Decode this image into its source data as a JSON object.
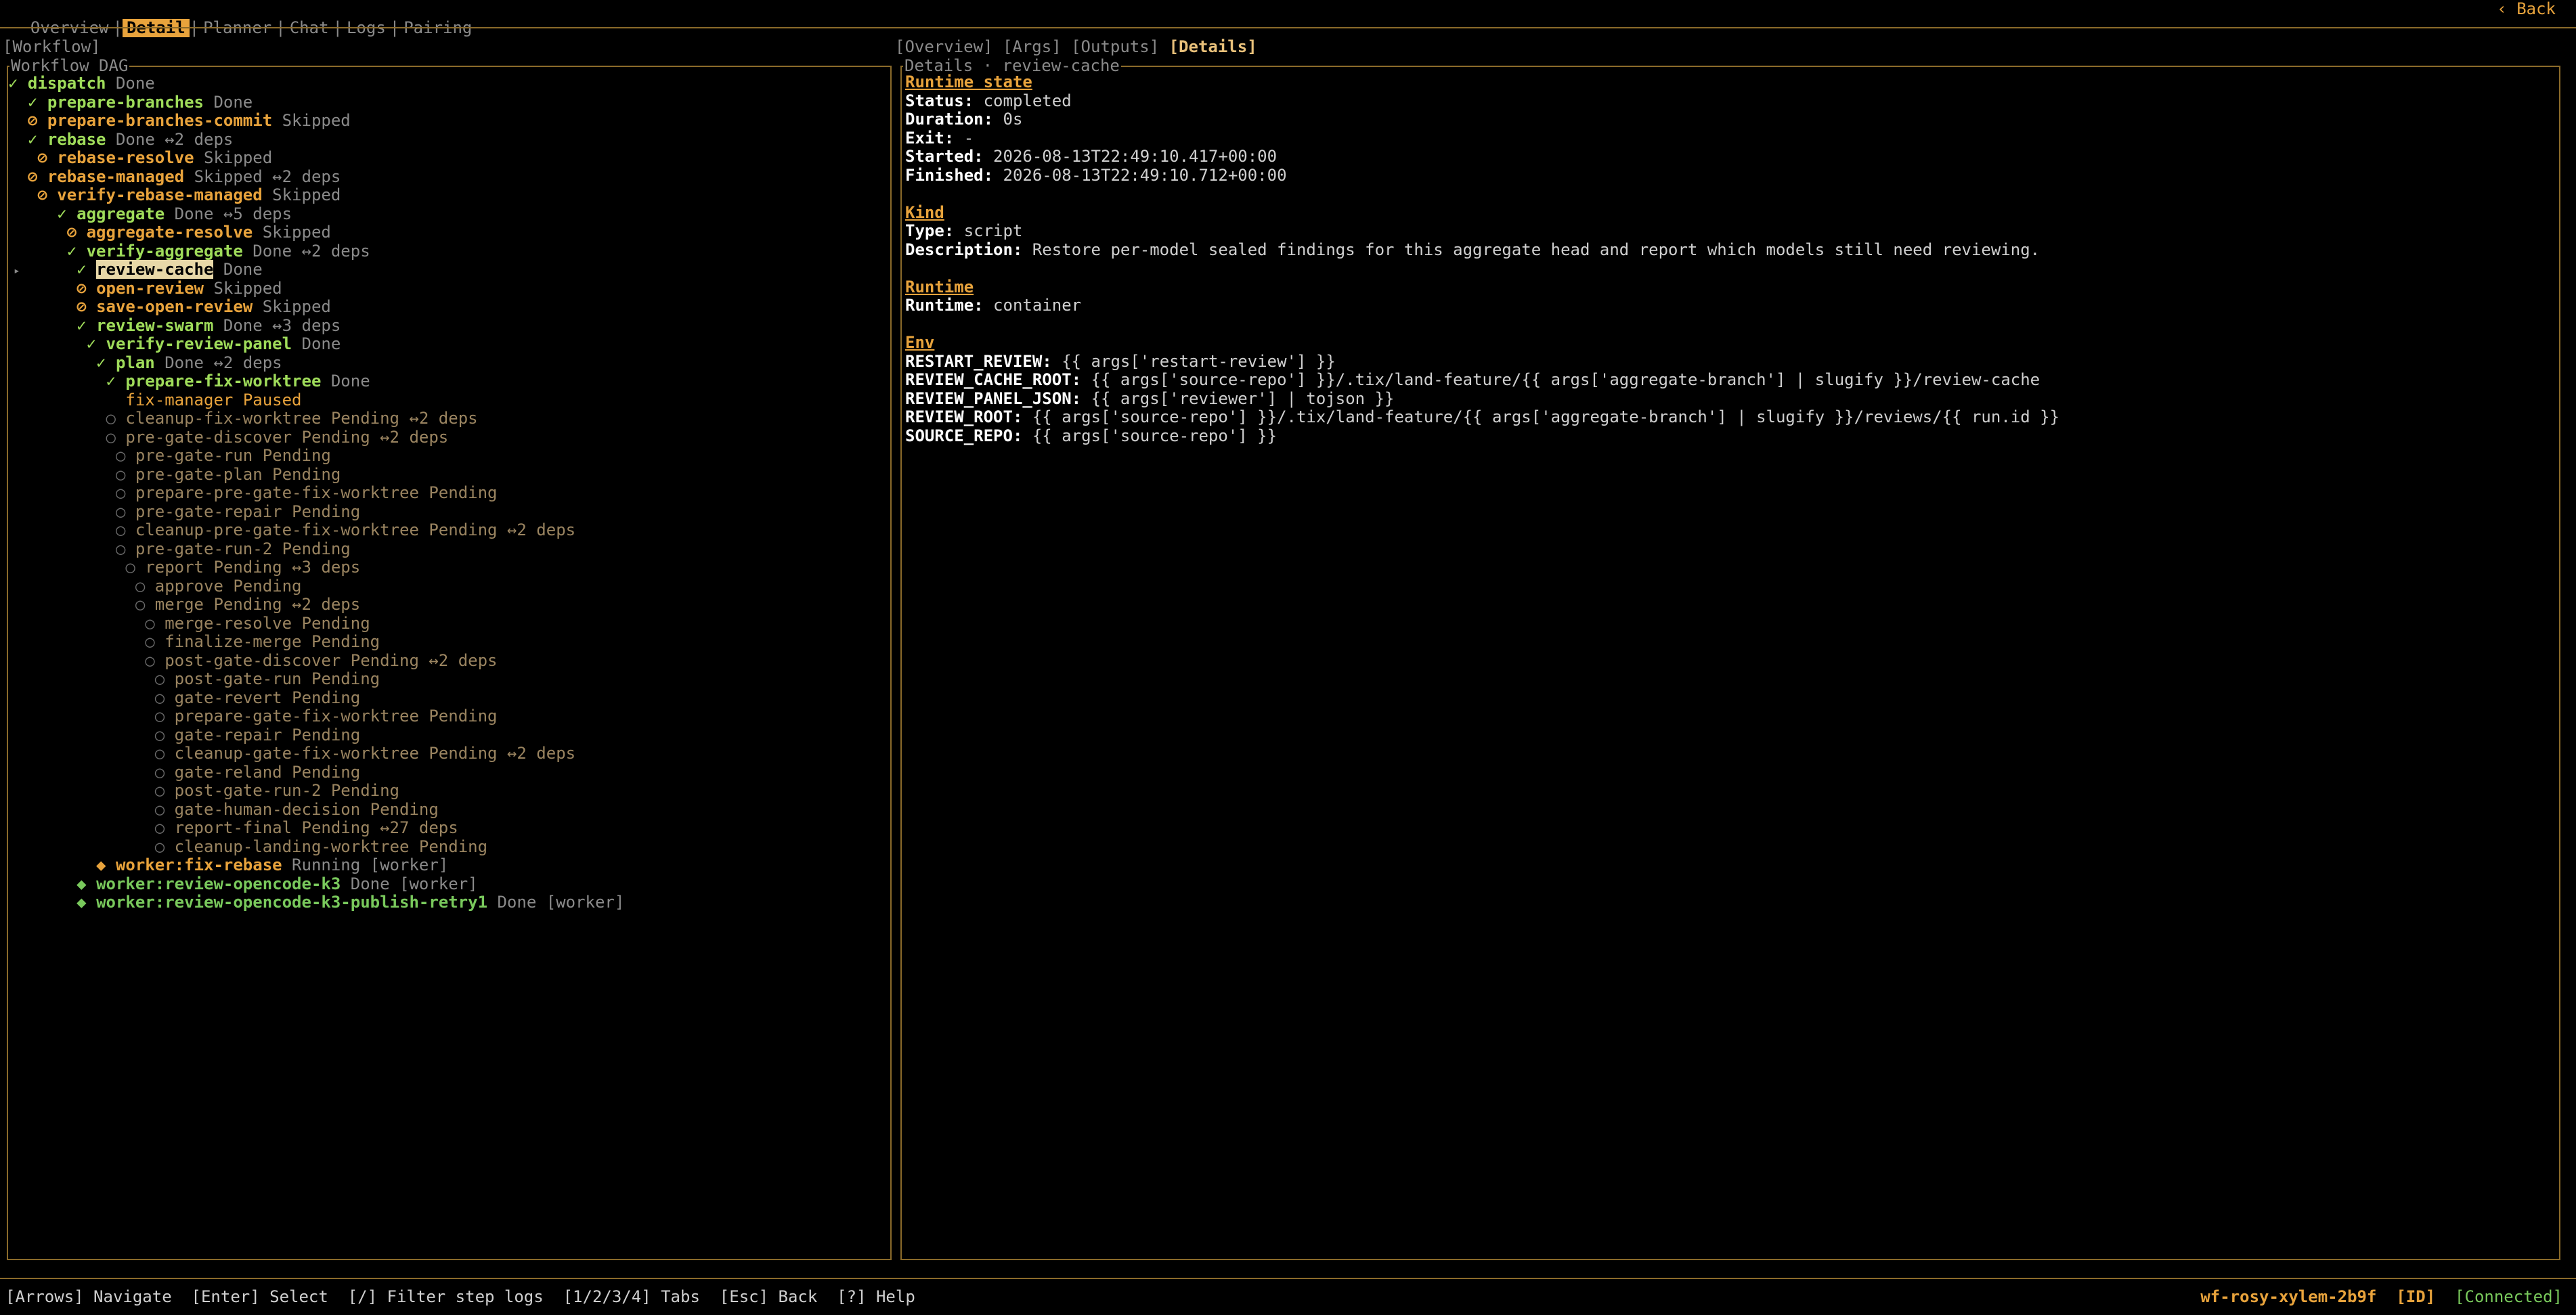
{
  "top_tabs": [
    "Overview",
    "Detail",
    "Planner",
    "Chat",
    "Logs",
    "Pairing"
  ],
  "back_label": "‹ Back",
  "workflow_label": "[Workflow]",
  "dag_title": "Workflow DAG",
  "detail_tabs": [
    "[Overview]",
    "[Args]",
    "[Outputs]",
    "[Details]"
  ],
  "details_title": "Details · review-cache",
  "tree": [
    {
      "g": "",
      "icon": "✓",
      "k": "done",
      "name": "dispatch",
      "status": "Done",
      "deps": ""
    },
    {
      "g": "  ",
      "icon": "✓",
      "k": "done",
      "name": "prepare-branches",
      "status": "Done",
      "deps": ""
    },
    {
      "g": "  ",
      "icon": "⊘",
      "k": "skip",
      "name": "prepare-branches-commit",
      "status": "Skipped",
      "deps": ""
    },
    {
      "g": "  ",
      "icon": "✓",
      "k": "done",
      "name": "rebase",
      "status": "Done",
      "deps": "↔2 deps"
    },
    {
      "g": "   ",
      "icon": "⊘",
      "k": "skip",
      "name": "rebase-resolve",
      "status": "Skipped",
      "deps": ""
    },
    {
      "g": "  ",
      "icon": "⊘",
      "k": "skip",
      "name": "rebase-managed",
      "status": "Skipped",
      "deps": "↔2 deps"
    },
    {
      "g": "   ",
      "icon": "⊘",
      "k": "skip",
      "name": "verify-rebase-managed",
      "status": "Skipped",
      "deps": ""
    },
    {
      "g": "     ",
      "icon": "✓",
      "k": "done",
      "name": "aggregate",
      "status": "Done",
      "deps": "↔5 deps"
    },
    {
      "g": "      ",
      "icon": "⊘",
      "k": "skip",
      "name": "aggregate-resolve",
      "status": "Skipped",
      "deps": ""
    },
    {
      "g": "      ",
      "icon": "✓",
      "k": "done",
      "name": "verify-aggregate",
      "status": "Done",
      "deps": "↔2 deps"
    },
    {
      "g": "       ",
      "icon": "✓",
      "k": "sel",
      "name": "review-cache",
      "status": "Done",
      "deps": ""
    },
    {
      "g": "       ",
      "icon": "⊘",
      "k": "skip",
      "name": "open-review",
      "status": "Skipped",
      "deps": ""
    },
    {
      "g": "       ",
      "icon": "⊘",
      "k": "skip",
      "name": "save-open-review",
      "status": "Skipped",
      "deps": ""
    },
    {
      "g": "       ",
      "icon": "✓",
      "k": "done",
      "name": "review-swarm",
      "status": "Done",
      "deps": "↔3 deps"
    },
    {
      "g": "        ",
      "icon": "✓",
      "k": "done",
      "name": "verify-review-panel",
      "status": "Done",
      "deps": ""
    },
    {
      "g": "         ",
      "icon": "✓",
      "k": "done",
      "name": "plan",
      "status": "Done",
      "deps": "↔2 deps"
    },
    {
      "g": "          ",
      "icon": "✓",
      "k": "done",
      "name": "prepare-fix-worktree",
      "status": "Done",
      "deps": ""
    },
    {
      "g": "          ",
      "icon": " ",
      "k": "pause",
      "name": "fix-manager",
      "status": "Paused",
      "deps": ""
    },
    {
      "g": "          ",
      "icon": "○",
      "k": "pend",
      "name": "cleanup-fix-worktree",
      "status": "Pending",
      "deps": "↔2 deps"
    },
    {
      "g": "          ",
      "icon": "○",
      "k": "pend",
      "name": "pre-gate-discover",
      "status": "Pending",
      "deps": "↔2 deps"
    },
    {
      "g": "           ",
      "icon": "○",
      "k": "pend",
      "name": "pre-gate-run",
      "status": "Pending",
      "deps": ""
    },
    {
      "g": "           ",
      "icon": "○",
      "k": "pend",
      "name": "pre-gate-plan",
      "status": "Pending",
      "deps": ""
    },
    {
      "g": "           ",
      "icon": "○",
      "k": "pend",
      "name": "prepare-pre-gate-fix-worktree",
      "status": "Pending",
      "deps": ""
    },
    {
      "g": "           ",
      "icon": "○",
      "k": "pend",
      "name": "pre-gate-repair",
      "status": "Pending",
      "deps": ""
    },
    {
      "g": "           ",
      "icon": "○",
      "k": "pend",
      "name": "cleanup-pre-gate-fix-worktree",
      "status": "Pending",
      "deps": "↔2 deps"
    },
    {
      "g": "           ",
      "icon": "○",
      "k": "pend",
      "name": "pre-gate-run-2",
      "status": "Pending",
      "deps": ""
    },
    {
      "g": "            ",
      "icon": "○",
      "k": "pend",
      "name": "report",
      "status": "Pending",
      "deps": "↔3 deps"
    },
    {
      "g": "             ",
      "icon": "○",
      "k": "pend",
      "name": "approve",
      "status": "Pending",
      "deps": ""
    },
    {
      "g": "             ",
      "icon": "○",
      "k": "pend",
      "name": "merge",
      "status": "Pending",
      "deps": "↔2 deps"
    },
    {
      "g": "              ",
      "icon": "○",
      "k": "pend",
      "name": "merge-resolve",
      "status": "Pending",
      "deps": ""
    },
    {
      "g": "              ",
      "icon": "○",
      "k": "pend",
      "name": "finalize-merge",
      "status": "Pending",
      "deps": ""
    },
    {
      "g": "              ",
      "icon": "○",
      "k": "pend",
      "name": "post-gate-discover",
      "status": "Pending",
      "deps": "↔2 deps"
    },
    {
      "g": "               ",
      "icon": "○",
      "k": "pend",
      "name": "post-gate-run",
      "status": "Pending",
      "deps": ""
    },
    {
      "g": "               ",
      "icon": "○",
      "k": "pend",
      "name": "gate-revert",
      "status": "Pending",
      "deps": ""
    },
    {
      "g": "               ",
      "icon": "○",
      "k": "pend",
      "name": "prepare-gate-fix-worktree",
      "status": "Pending",
      "deps": ""
    },
    {
      "g": "               ",
      "icon": "○",
      "k": "pend",
      "name": "gate-repair",
      "status": "Pending",
      "deps": ""
    },
    {
      "g": "               ",
      "icon": "○",
      "k": "pend",
      "name": "cleanup-gate-fix-worktree",
      "status": "Pending",
      "deps": "↔2 deps"
    },
    {
      "g": "               ",
      "icon": "○",
      "k": "pend",
      "name": "gate-reland",
      "status": "Pending",
      "deps": ""
    },
    {
      "g": "               ",
      "icon": "○",
      "k": "pend",
      "name": "post-gate-run-2",
      "status": "Pending",
      "deps": ""
    },
    {
      "g": "               ",
      "icon": "○",
      "k": "pend",
      "name": "gate-human-decision",
      "status": "Pending",
      "deps": ""
    },
    {
      "g": "               ",
      "icon": "○",
      "k": "pend",
      "name": "report-final",
      "status": "Pending",
      "deps": "↔27 deps"
    },
    {
      "g": "               ",
      "icon": "○",
      "k": "pend",
      "name": "cleanup-landing-worktree",
      "status": "Pending",
      "deps": ""
    },
    {
      "g": "         ",
      "icon": "◆",
      "k": "run",
      "name": "worker:fix-rebase",
      "status": "Running [worker]",
      "deps": ""
    },
    {
      "g": "       ",
      "icon": "◆",
      "k": "wdone",
      "name": "worker:review-opencode-k3",
      "status": "Done [worker]",
      "deps": ""
    },
    {
      "g": "       ",
      "icon": "◆",
      "k": "wdone",
      "name": "worker:review-opencode-k3-publish-retry1",
      "status": "Done [worker]",
      "deps": ""
    }
  ],
  "details": {
    "runtime_state": {
      "heading": "Runtime state",
      "rows": [
        {
          "k": "Status:",
          "v": "completed"
        },
        {
          "k": "Duration:",
          "v": "0s"
        },
        {
          "k": "Exit:",
          "v": "-"
        },
        {
          "k": "Started:",
          "v": "2026-08-13T22:49:10.417+00:00"
        },
        {
          "k": "Finished:",
          "v": "2026-08-13T22:49:10.712+00:00"
        }
      ]
    },
    "kind": {
      "heading": "Kind",
      "rows": [
        {
          "k": "Type:",
          "v": "script"
        },
        {
          "k": "Description:",
          "v": "Restore per-model sealed findings for this aggregate head and report which models still need reviewing."
        }
      ]
    },
    "runtime": {
      "heading": "Runtime",
      "rows": [
        {
          "k": "Runtime:",
          "v": "container"
        }
      ]
    },
    "env": {
      "heading": "Env",
      "rows": [
        {
          "k": "RESTART_REVIEW:",
          "v": "{{ args['restart-review'] }}"
        },
        {
          "k": "REVIEW_CACHE_ROOT:",
          "v": "{{ args['source-repo'] }}/.tix/land-feature/{{ args['aggregate-branch'] | slugify }}/review-cache"
        },
        {
          "k": "REVIEW_PANEL_JSON:",
          "v": "{{ args['reviewer'] | tojson }}"
        },
        {
          "k": "REVIEW_ROOT:",
          "v": "{{ args['source-repo'] }}/.tix/land-feature/{{ args['aggregate-branch'] | slugify }}/reviews/{{ run.id }}"
        },
        {
          "k": "SOURCE_REPO:",
          "v": "{{ args['source-repo'] }}"
        }
      ]
    }
  },
  "footer": {
    "hints": "[Arrows] Navigate  [Enter] Select  [/] Filter step logs  [1/2/3/4] Tabs  [Esc] Back  [?] Help",
    "workflow_id": "wf-rosy-xylem-2b9f",
    "id_label": "[ID]",
    "connection": "[Connected]"
  },
  "colors": {
    "accent": "#e8a33c",
    "done": "#9fdc5a",
    "border": "#8a6a2a",
    "background": "#000000"
  }
}
